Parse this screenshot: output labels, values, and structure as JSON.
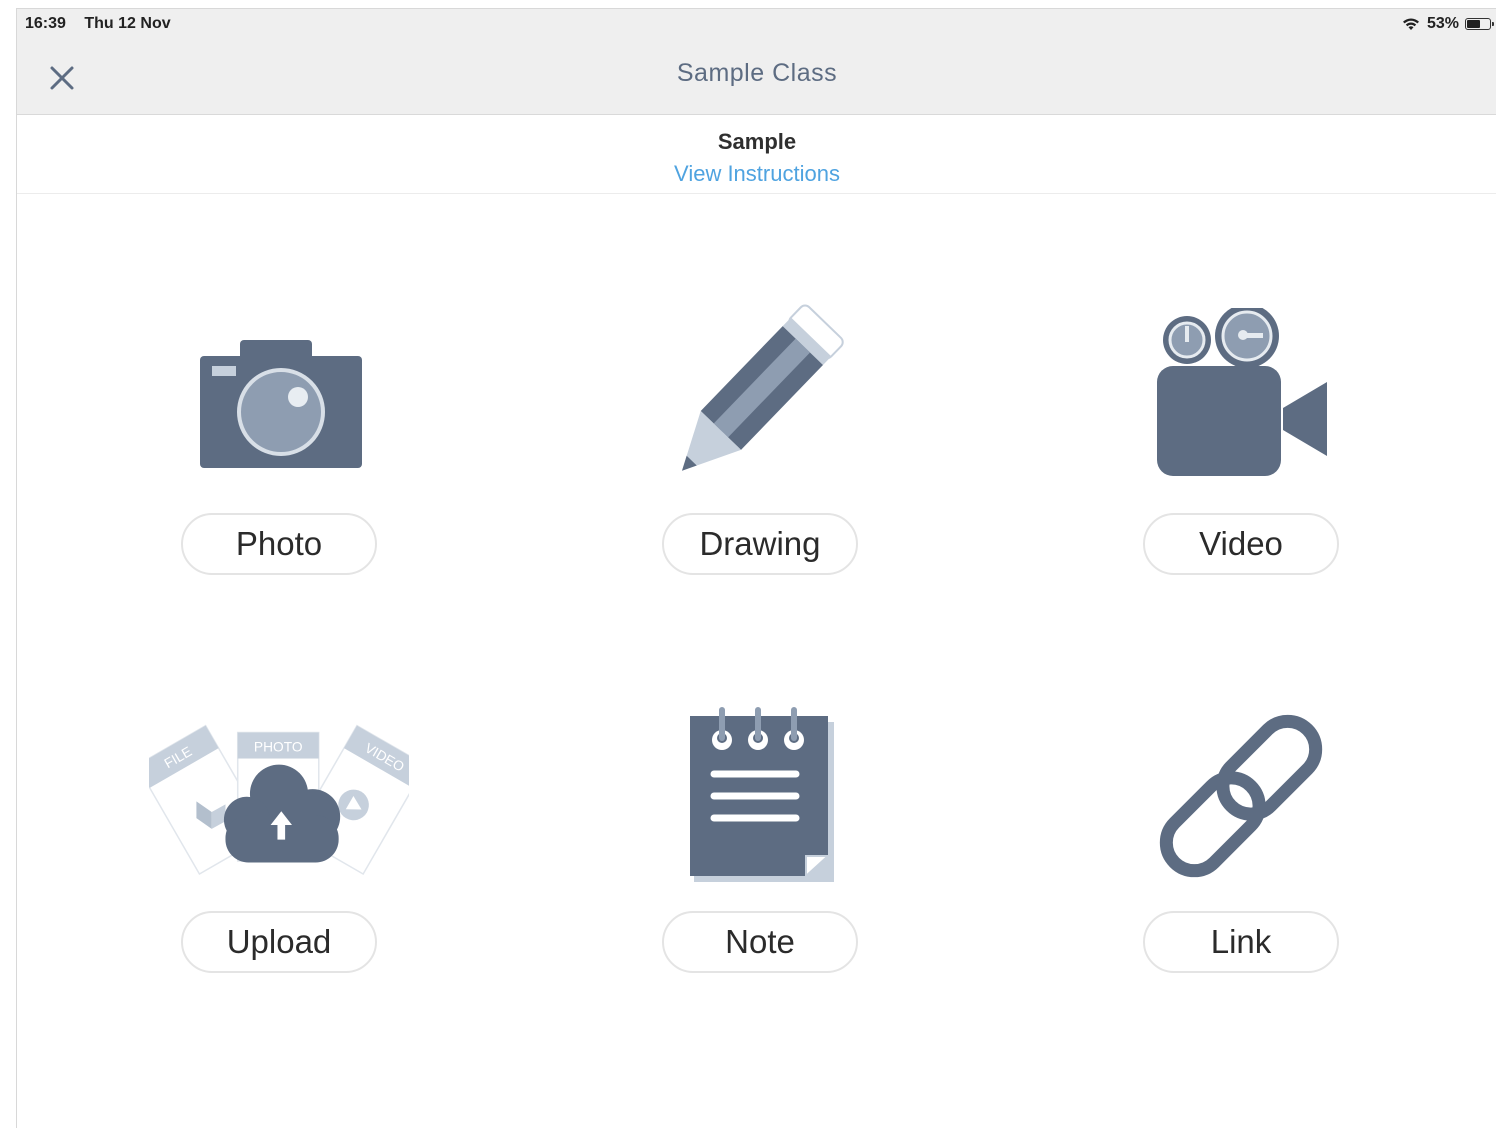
{
  "status_bar": {
    "time": "16:39",
    "date": "Thu 12 Nov",
    "battery_percent_label": "53%",
    "battery_level": 0.53
  },
  "header": {
    "title": "Sample Class",
    "close_icon": "close-icon"
  },
  "subheader": {
    "title": "Sample",
    "instructions_link": "View Instructions"
  },
  "options": [
    {
      "label": "Photo",
      "icon": "camera-icon"
    },
    {
      "label": "Drawing",
      "icon": "pencil-icon"
    },
    {
      "label": "Video",
      "icon": "video-camera-icon"
    },
    {
      "label": "Upload",
      "icon": "upload-cloud-icon",
      "card_labels": [
        "FILE",
        "PHOTO",
        "VIDEO"
      ]
    },
    {
      "label": "Note",
      "icon": "notepad-icon"
    },
    {
      "label": "Link",
      "icon": "link-icon"
    }
  ],
  "colors": {
    "icon_dark": "#5d6c82",
    "icon_light": "#8e9db1",
    "accent_link": "#4fa3e0",
    "header_bg": "#efefef"
  }
}
